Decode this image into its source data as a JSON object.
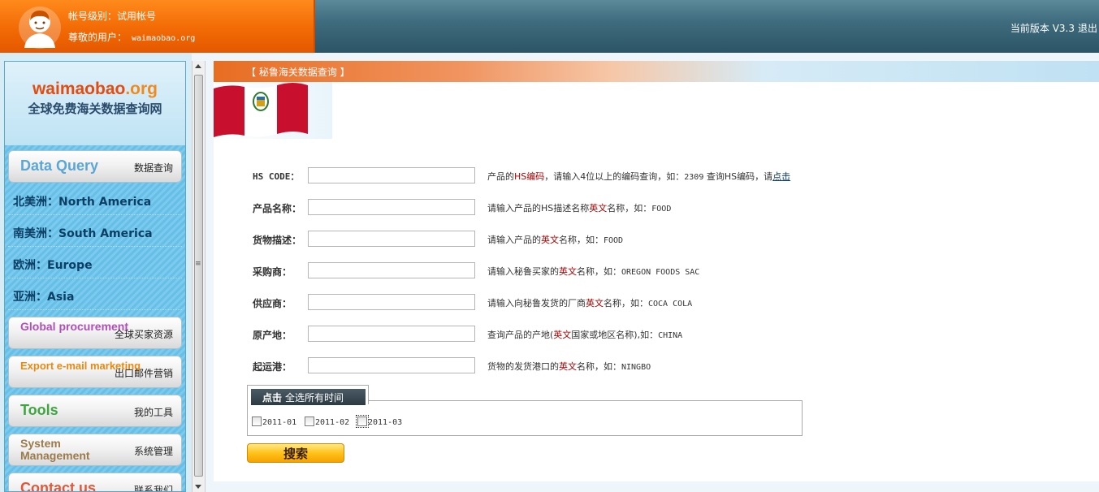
{
  "header": {
    "account_level": "帐号级别：试用帐号",
    "user_label": "尊敬的用户：",
    "user_name": "waimaobao.org",
    "version": "当前版本 V3.3",
    "logout": "退出"
  },
  "sidebar": {
    "brand_name_main": "waimaobao",
    "brand_name_dot": ".org",
    "brand_tagline": "全球免费海关数据查询网",
    "nav_top": {
      "en": "Data Query",
      "cn": "数据查询",
      "color": "#5aa6d6"
    },
    "regions": [
      {
        "label": "北美洲：North America"
      },
      {
        "label": "南美洲：South America"
      },
      {
        "label": "欧洲：Europe"
      },
      {
        "label": "亚洲：Asia"
      }
    ],
    "nav_buttons": [
      {
        "en": "Global procurement",
        "cn": "全球买家资源",
        "color": "#b04fb8"
      },
      {
        "en": "Export e-mail marketing",
        "cn": "出口邮件营销",
        "color": "#e68a12"
      },
      {
        "en": "Tools",
        "cn": "我的工具",
        "color": "#3fa63f"
      },
      {
        "en": "System Management",
        "cn": "系统管理",
        "color": "#9c7a4a"
      },
      {
        "en": "Contact us",
        "cn": "联系我们",
        "color": "#e2573a"
      }
    ]
  },
  "main": {
    "title": "【 秘鲁海关数据查询 】",
    "fields": [
      {
        "label": "HS CODE：",
        "hint_parts": [
          "产品的",
          "HS编码",
          "，请输入4位以上的编码查询，如：",
          "2309",
          " 查询HS编码，请",
          "点击"
        ]
      },
      {
        "label": "产品名称：",
        "hint_parts": [
          "请输入产品的HS描述名称",
          "英文",
          "名称，如：",
          "FOOD"
        ]
      },
      {
        "label": "货物描述：",
        "hint_parts": [
          "请输入产品的",
          "英文",
          "名称，如：",
          "FOOD"
        ]
      },
      {
        "label": "采购商：",
        "hint_parts": [
          "请输入秘鲁买家的",
          "英文",
          "名称，如：",
          "OREGON FOODS SAC"
        ]
      },
      {
        "label": "供应商：",
        "hint_parts": [
          "请输入向秘鲁发货的厂商",
          "英文",
          "名称，如：",
          "COCA COLA"
        ]
      },
      {
        "label": "原产地：",
        "hint_parts": [
          "查询产品的产地(",
          "英文",
          "国家或地区名称),如：",
          "CHINA"
        ]
      },
      {
        "label": "起运港：",
        "hint_parts": [
          "货物的发货港口的",
          "英文",
          "名称，如：",
          "NINGBO"
        ]
      }
    ],
    "time_tab_bold": "点击",
    "time_tab_label": "全选所有时间",
    "periods": [
      "2011-01",
      "2011-02",
      "2011-03"
    ],
    "search_button": "搜索"
  }
}
